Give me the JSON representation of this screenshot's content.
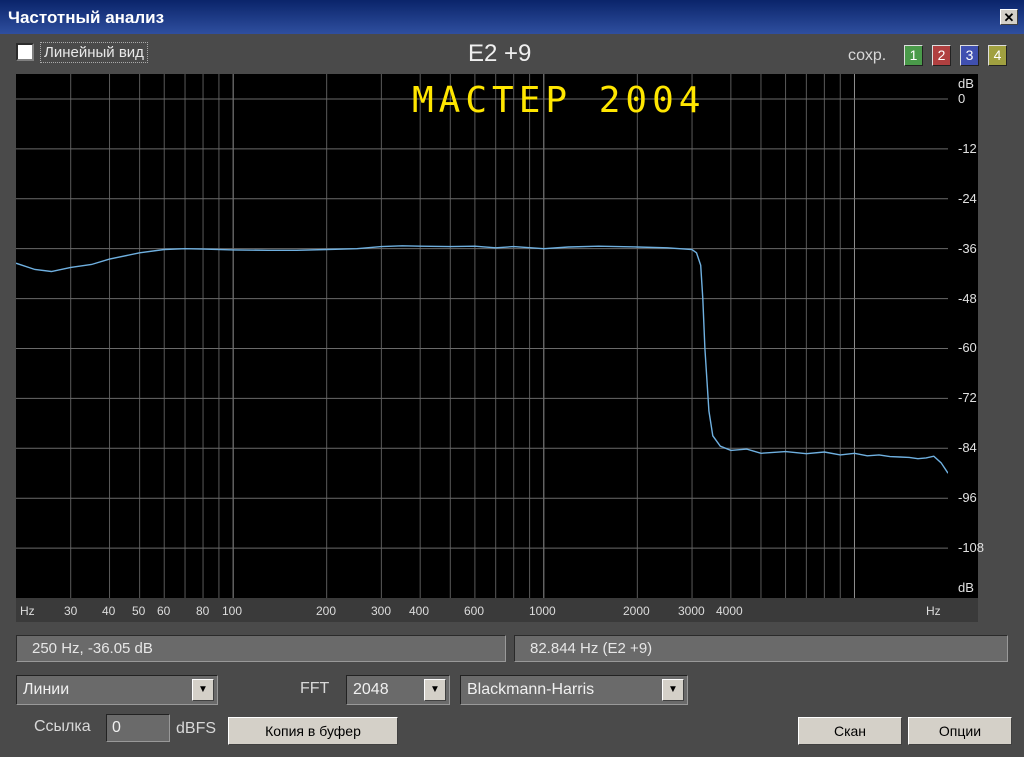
{
  "window": {
    "title": "Частотный анализ",
    "close_label": "✕"
  },
  "header": {
    "linear_view_label": "Линейный вид",
    "linear_view_checked": false,
    "chart_title": "E2 +9",
    "overlay_text": "MACTEP 2004",
    "saves_label": "сохр.",
    "saves": [
      {
        "label": "1",
        "color": "#4a9a4a"
      },
      {
        "label": "2",
        "color": "#b04040"
      },
      {
        "label": "3",
        "color": "#4050b0"
      },
      {
        "label": "4",
        "color": "#a0a040"
      }
    ]
  },
  "chart_data": {
    "type": "line",
    "x_scale": "log",
    "xlim": [
      20,
      20000
    ],
    "ylim": [
      -120,
      6
    ],
    "y_unit_label": "dB",
    "x_unit_label": "Hz",
    "y_ticks": [
      0,
      -12,
      -24,
      -36,
      -48,
      -60,
      -72,
      -84,
      -96,
      -108
    ],
    "x_ticks": [
      {
        "value": 30,
        "label": "30"
      },
      {
        "value": 40,
        "label": "40"
      },
      {
        "value": 50,
        "label": "50"
      },
      {
        "value": 60,
        "label": "60"
      },
      {
        "value": 80,
        "label": "80"
      },
      {
        "value": 100,
        "label": "100"
      },
      {
        "value": 200,
        "label": "200"
      },
      {
        "value": 300,
        "label": "300"
      },
      {
        "value": 400,
        "label": "400"
      },
      {
        "value": 600,
        "label": "600"
      },
      {
        "value": 1000,
        "label": "1000"
      },
      {
        "value": 2000,
        "label": "2000"
      },
      {
        "value": 3000,
        "label": "3000"
      },
      {
        "value": 4000,
        "label": "4000"
      }
    ],
    "grid": true,
    "line_color": "#6fb0e0",
    "series": [
      {
        "x": [
          20,
          23,
          26,
          30,
          35,
          40,
          50,
          60,
          70,
          80,
          100,
          130,
          160,
          200,
          250,
          300,
          350,
          400,
          500,
          600,
          700,
          800,
          1000,
          1200,
          1500,
          2000,
          2500,
          3000,
          3100,
          3200,
          3250,
          3300,
          3400,
          3500,
          3700,
          4000,
          4500,
          5000,
          6000,
          7000,
          8000,
          9000,
          10000,
          11000,
          12000,
          13000,
          14000,
          15000,
          16000,
          17000,
          18000,
          19000,
          20000
        ],
        "y": [
          -39.5,
          -41,
          -41.5,
          -40.5,
          -39.8,
          -38.5,
          -37,
          -36.2,
          -36,
          -36.1,
          -36.3,
          -36.4,
          -36.4,
          -36.2,
          -36.0,
          -35.5,
          -35.3,
          -35.4,
          -35.5,
          -35.4,
          -35.8,
          -35.5,
          -36.0,
          -35.6,
          -35.4,
          -35.6,
          -35.8,
          -36.2,
          -37,
          -40,
          -48,
          -60,
          -75,
          -81,
          -83.5,
          -84.5,
          -84.2,
          -85.2,
          -84.8,
          -85.3,
          -84.9,
          -85.6,
          -85.2,
          -85.8,
          -85.6,
          -86.0,
          -86.1,
          -86.2,
          -86.5,
          -86.3,
          -85.9,
          -87.5,
          -90
        ]
      }
    ]
  },
  "readouts": {
    "cursor": "250 Hz, -36.05 dB",
    "peak": "82.844 Hz (E2 +9)"
  },
  "controls": {
    "display_mode": "Линии",
    "fft_label": "FFT",
    "fft_size": "2048",
    "window_fn": "Blackmann-Harris",
    "ref_label": "Ссылка",
    "ref_value": "0",
    "dbfs_label": "dBFS",
    "copy_label": "Копия в буфер",
    "scan_label": "Скан",
    "options_label": "Опции"
  }
}
